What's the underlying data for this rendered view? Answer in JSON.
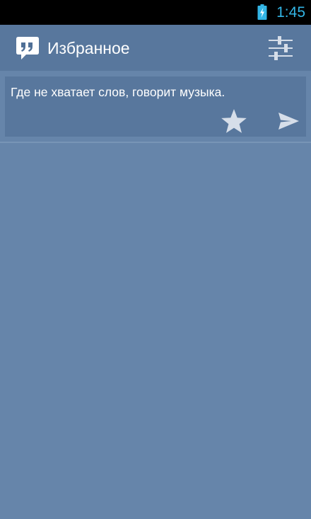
{
  "status_bar": {
    "time": "1:45",
    "battery_icon": "battery-charging-icon",
    "accent_color": "#33b5e5"
  },
  "action_bar": {
    "title": "Избранное",
    "app_icon": "quote-bubble-icon",
    "settings_icon": "sliders-icon",
    "background": "#58779d"
  },
  "favorites": {
    "items": [
      {
        "text": "Где не хватает слов, говорит музыка.",
        "favorite_icon": "star-icon",
        "share_icon": "send-icon"
      }
    ]
  },
  "colors": {
    "background": "#6685aa",
    "card": "#58779d",
    "icon": "#d6dee9"
  }
}
